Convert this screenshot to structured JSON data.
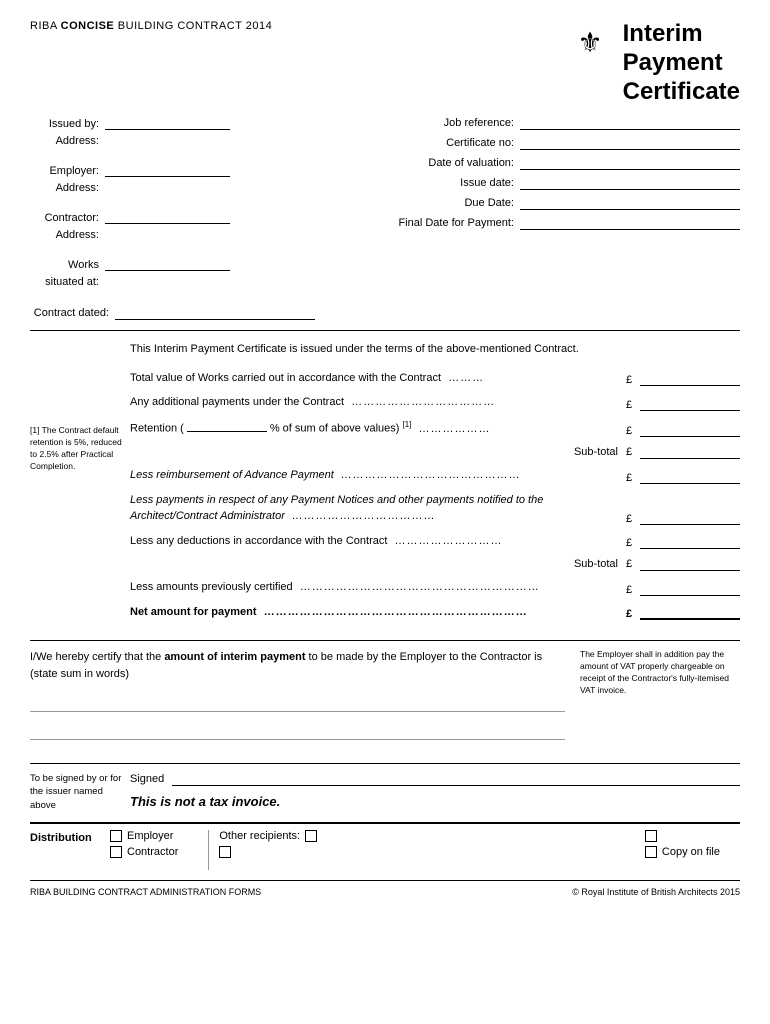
{
  "header": {
    "title_part1": "RIBA ",
    "title_concise": "CONCISE",
    "title_part2": " BUILDING CONTRACT 2014",
    "certificate_title_line1": "Interim",
    "certificate_title_line2": "Payment",
    "certificate_title_line3": "Certificate"
  },
  "left_fields": {
    "issued_by_label": "Issued by:",
    "address_label": "Address:",
    "employer_label": "Employer:",
    "employer_address_label": "Address:",
    "contractor_label": "Contractor:",
    "contractor_address_label": "Address:",
    "works_label": "Works",
    "situated_label": "situated at:",
    "contract_dated_label": "Contract dated:"
  },
  "right_fields": {
    "job_ref_label": "Job reference:",
    "cert_no_label": "Certificate no:",
    "date_valuation_label": "Date of valuation:",
    "issue_date_label": "Issue date:",
    "due_date_label": "Due Date:",
    "final_date_label": "Final Date for Payment:"
  },
  "intro_text": "This Interim Payment Certificate is issued under the terms of the above-mentioned Contract.",
  "calc_rows": [
    {
      "id": "total_value",
      "text": "Total value of Works carried out in accordance with the Contract",
      "dots": "………",
      "currency": "£"
    },
    {
      "id": "additional_payments",
      "text": "Any additional payments under the Contract",
      "dots": "………………………………",
      "currency": "£"
    },
    {
      "id": "retention",
      "text": "Retention (",
      "blank": true,
      "text2": "% of sum of above values)",
      "superscript": "[1]",
      "dots": "………………",
      "currency": "£"
    }
  ],
  "subtotal1_label": "Sub-total",
  "subtotal1_currency": "£",
  "calc_rows2": [
    {
      "id": "advance_payment",
      "text": "Less reimbursement of Advance Payment",
      "italic": true,
      "dots": "………………………………………",
      "currency": "£"
    },
    {
      "id": "payment_notices",
      "text": "Less payments in respect of any Payment Notices and other payments notified to the Architect/Contract Administrator",
      "italic": true,
      "dots": "………………………………",
      "currency": "£"
    },
    {
      "id": "deductions",
      "text": "Less any deductions in accordance with the Contract",
      "dots": "………………………",
      "currency": "£"
    }
  ],
  "subtotal2_label": "Sub-total",
  "subtotal2_currency": "£",
  "calc_rows3": [
    {
      "id": "previously_certified",
      "text": "Less amounts previously certified",
      "dots": "……………………………………………………",
      "currency": "£"
    },
    {
      "id": "net_amount",
      "text": "Net amount for payment",
      "bold": true,
      "dots": "…………………………………………………………",
      "currency": "£"
    }
  ],
  "footnote": "[1] The Contract default retention is 5%, reduced to 2.5% after Practical Completion.",
  "cert_text_part1": "I/We hereby certify that the ",
  "cert_text_bold": "amount of interim payment",
  "cert_text_part2": " to be made by the Employer to the Contractor is (state sum in words)",
  "cert_note": "The Employer shall in addition pay the amount of VAT properly chargeable on receipt of the Contractor's fully-itemised VAT invoice.",
  "sign_section": {
    "label": "To be signed by or for the issuer named above",
    "signed_label": "Signed",
    "not_tax_invoice": "This is not a tax invoice."
  },
  "distribution": {
    "label": "Distribution",
    "employer_label": "Employer",
    "contractor_label": "Contractor",
    "other_recipients_label": "Other recipients:",
    "copy_on_file_label": "Copy on file"
  },
  "footer": {
    "left": "RIBA BUILDING CONTRACT ADMINISTRATION FORMS",
    "right": "© Royal Institute of British Architects 2015"
  }
}
